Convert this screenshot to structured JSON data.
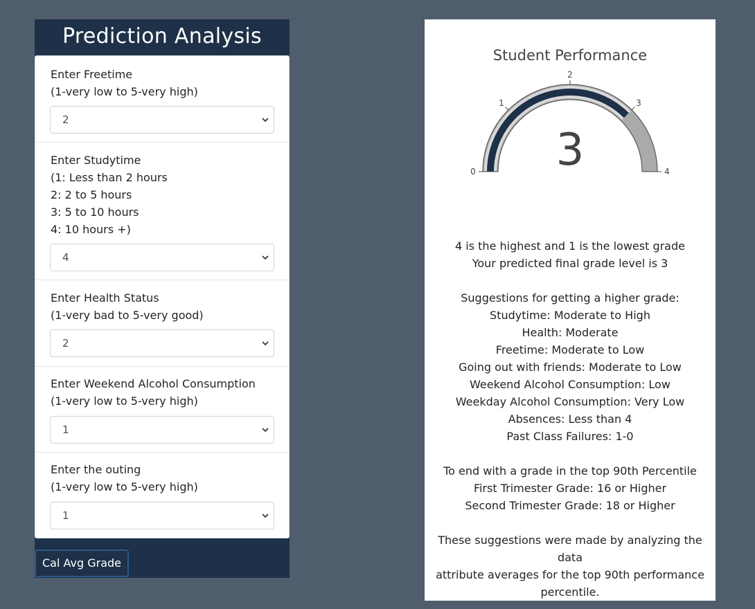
{
  "form": {
    "title": "Prediction Analysis",
    "fields": [
      {
        "label_lines": [
          "Enter Freetime",
          "(1-very low to 5-very high)"
        ],
        "value": "2"
      },
      {
        "label_lines": [
          "Enter Studytime",
          "(1: Less than 2 hours",
          "2: 2 to 5 hours",
          "3: 5 to 10 hours",
          "4: 10 hours +)"
        ],
        "value": "4"
      },
      {
        "label_lines": [
          "Enter Health Status",
          "(1-very bad to 5-very good)"
        ],
        "value": "2"
      },
      {
        "label_lines": [
          "Enter Weekend Alcohol Consumption",
          "(1-very low to 5-very high)"
        ],
        "value": "1"
      },
      {
        "label_lines": [
          "Enter the outing",
          "(1-very low to 5-very high)"
        ],
        "value": "1"
      }
    ],
    "button_label": "Cal Avg Grade"
  },
  "gauge": {
    "title": "Student Performance",
    "value": 3,
    "value_label": "3",
    "min": 0,
    "max": 4,
    "tick_labels": [
      "0",
      "1",
      "2",
      "3",
      "4"
    ],
    "colors": {
      "bar": "#1e3148",
      "track": "#aaaaaa",
      "step": "#d9d9d9",
      "text": "#444444"
    }
  },
  "results": {
    "lines": [
      "4 is the highest and 1 is the lowest grade",
      "Your predicted final grade level is 3",
      "",
      "Suggestions for getting a higher grade:",
      "Studytime: Moderate to High",
      "Health: Moderate",
      "Freetime: Moderate to Low",
      "Going out with friends: Moderate to Low",
      "Weekend Alcohol Consumption: Low",
      "Weekday Alcohol Consumption: Very Low",
      "Absences: Less than 4",
      "Past Class Failures: 1-0",
      "",
      "To end with a grade in the top 90th Percentile",
      "First Trimester Grade: 16 or Higher",
      "Second Trimester Grade: 18 or Higher",
      "",
      "These suggestions were made by analyzing the data",
      "attribute averages for the top 90th performance",
      "percentile."
    ]
  }
}
